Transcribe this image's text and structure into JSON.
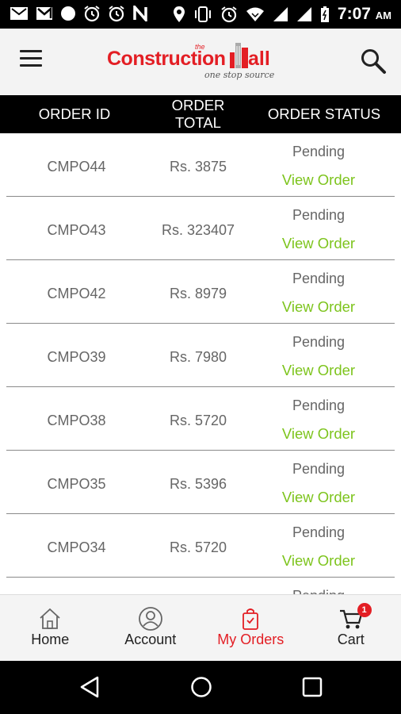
{
  "status_bar": {
    "time": "7:07",
    "ampm": "AM",
    "icons": [
      "mail-icon",
      "gmail-icon",
      "dot-icon",
      "alarm-icon",
      "alarm-icon",
      "n-icon",
      "location-icon",
      "vibrate-icon",
      "alarm-icon",
      "wifi-icon",
      "signal-icon",
      "signal-icon",
      "battery-icon"
    ]
  },
  "header": {
    "logo_text": "Construction",
    "logo_the": "the",
    "logo_all": "all",
    "logo_tagline": "one stop source"
  },
  "table": {
    "columns": [
      "ORDER ID",
      "ORDER TOTAL",
      "ORDER STATUS"
    ],
    "rows": [
      {
        "id": "CMPO44",
        "total": "Rs. 3875",
        "status": "Pending",
        "action": "View Order"
      },
      {
        "id": "CMPO43",
        "total": "Rs. 323407",
        "status": "Pending",
        "action": "View Order"
      },
      {
        "id": "CMPO42",
        "total": "Rs. 8979",
        "status": "Pending",
        "action": "View Order"
      },
      {
        "id": "CMPO39",
        "total": "Rs. 7980",
        "status": "Pending",
        "action": "View Order"
      },
      {
        "id": "CMPO38",
        "total": "Rs. 5720",
        "status": "Pending",
        "action": "View Order"
      },
      {
        "id": "CMPO35",
        "total": "Rs. 5396",
        "status": "Pending",
        "action": "View Order"
      },
      {
        "id": "CMPO34",
        "total": "Rs. 5720",
        "status": "Pending",
        "action": "View Order"
      },
      {
        "id": "",
        "total": "",
        "status": "Pending",
        "action": ""
      }
    ]
  },
  "bottom_nav": {
    "items": [
      {
        "label": "Home",
        "icon": "home-icon"
      },
      {
        "label": "Account",
        "icon": "account-icon"
      },
      {
        "label": "My Orders",
        "icon": "orders-bag-icon"
      },
      {
        "label": "Cart",
        "icon": "cart-icon"
      }
    ],
    "active": "My Orders",
    "cart_badge": "1"
  },
  "colors": {
    "brand_red": "#e31e24",
    "view_order_green": "#7dc41d",
    "header_black": "#000000"
  }
}
